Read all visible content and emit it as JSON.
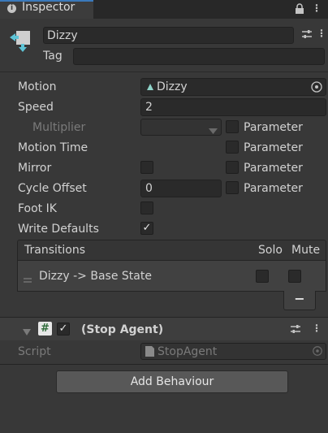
{
  "tab": {
    "title": "Inspector"
  },
  "object": {
    "name": "Dizzy",
    "tag_label": "Tag",
    "tag_value": ""
  },
  "properties": {
    "motion_label": "Motion",
    "motion_value": "Dizzy",
    "speed_label": "Speed",
    "speed_value": "2",
    "multiplier_label": "Multiplier",
    "multiplier_value": "",
    "motion_time_label": "Motion Time",
    "mirror_label": "Mirror",
    "mirror_checked": false,
    "cycle_offset_label": "Cycle Offset",
    "cycle_offset_value": "0",
    "foot_ik_label": "Foot IK",
    "foot_ik_checked": false,
    "write_defaults_label": "Write Defaults",
    "write_defaults_checked": true,
    "parameter_label": "Parameter"
  },
  "transitions": {
    "header": "Transitions",
    "solo_label": "Solo",
    "mute_label": "Mute",
    "items": [
      {
        "label": "Dizzy -> Base State",
        "solo": false,
        "mute": false
      }
    ],
    "remove_label": "−"
  },
  "component": {
    "title": "(Stop Agent)",
    "enabled": true,
    "script_label": "Script",
    "script_value": "StopAgent"
  },
  "add_behaviour_label": "Add Behaviour",
  "colors": {
    "accent": "#3a79bb",
    "background": "#383838",
    "field": "#2a2a2a",
    "text": "#d2d2d2"
  }
}
